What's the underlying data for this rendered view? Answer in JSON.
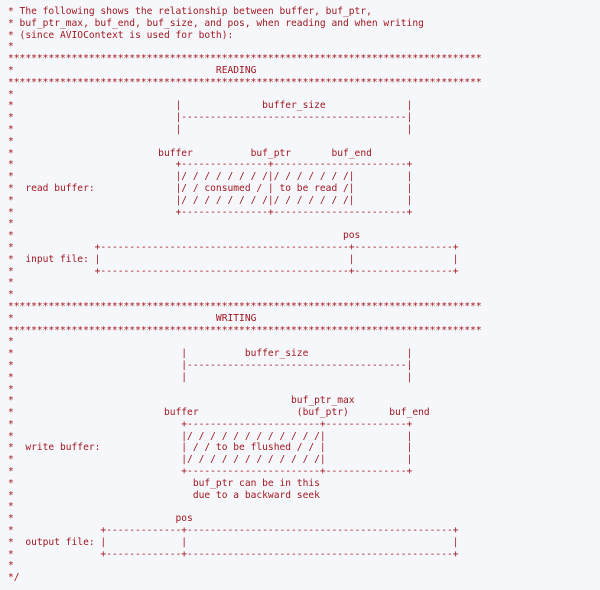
{
  "intro": [
    "* The following shows the relationship between buffer, buf_ptr,",
    "* buf_ptr_max, buf_end, buf_size, and pos, when reading and when writing",
    "* (since AVIOContext is used for both):",
    "*"
  ],
  "reading": [
    "**********************************************************************************",
    "*                                   READING",
    "**********************************************************************************",
    "*",
    "*                            |              buffer_size              |",
    "*                            |---------------------------------------|",
    "*                            |                                       |",
    "*",
    "*                         buffer          buf_ptr       buf_end",
    "*                            +---------------+-----------------------+",
    "*                            |/ / / / / / / /|/ / / / / / /|         |",
    "*  read buffer:              |/ / consumed / | to be read /|         |",
    "*                            |/ / / / / / / /|/ / / / / / /|         |",
    "*                            +---------------+-----------------------+",
    "*",
    "*                                                         pos",
    "*              +-------------------------------------------+-----------------+",
    "*  input file: |                                           |                 |",
    "*              +-------------------------------------------+-----------------+",
    "*",
    "*"
  ],
  "writing": [
    "**********************************************************************************",
    "*                                   WRITING",
    "**********************************************************************************",
    "*",
    "*                             |          buffer_size                 |",
    "*                             |--------------------------------------|",
    "*                             |                                      |",
    "*",
    "*                                                buf_ptr_max",
    "*                          buffer                 (buf_ptr)       buf_end",
    "*                             +-----------------------+--------------+",
    "*                             |/ / / / / / / / / / / /|              |",
    "*  write buffer:              | / / to be flushed / / |              |",
    "*                             |/ / / / / / / / / / / /|              |",
    "*                             +-----------------------+--------------+",
    "*                               buf_ptr can be in this",
    "*                               due to a backward seek",
    "*",
    "*                            pos",
    "*               +-------------+----------------------------------------------+",
    "*  output file: |             |                                              |",
    "*               +-------------+----------------------------------------------+",
    "*",
    "*/"
  ]
}
